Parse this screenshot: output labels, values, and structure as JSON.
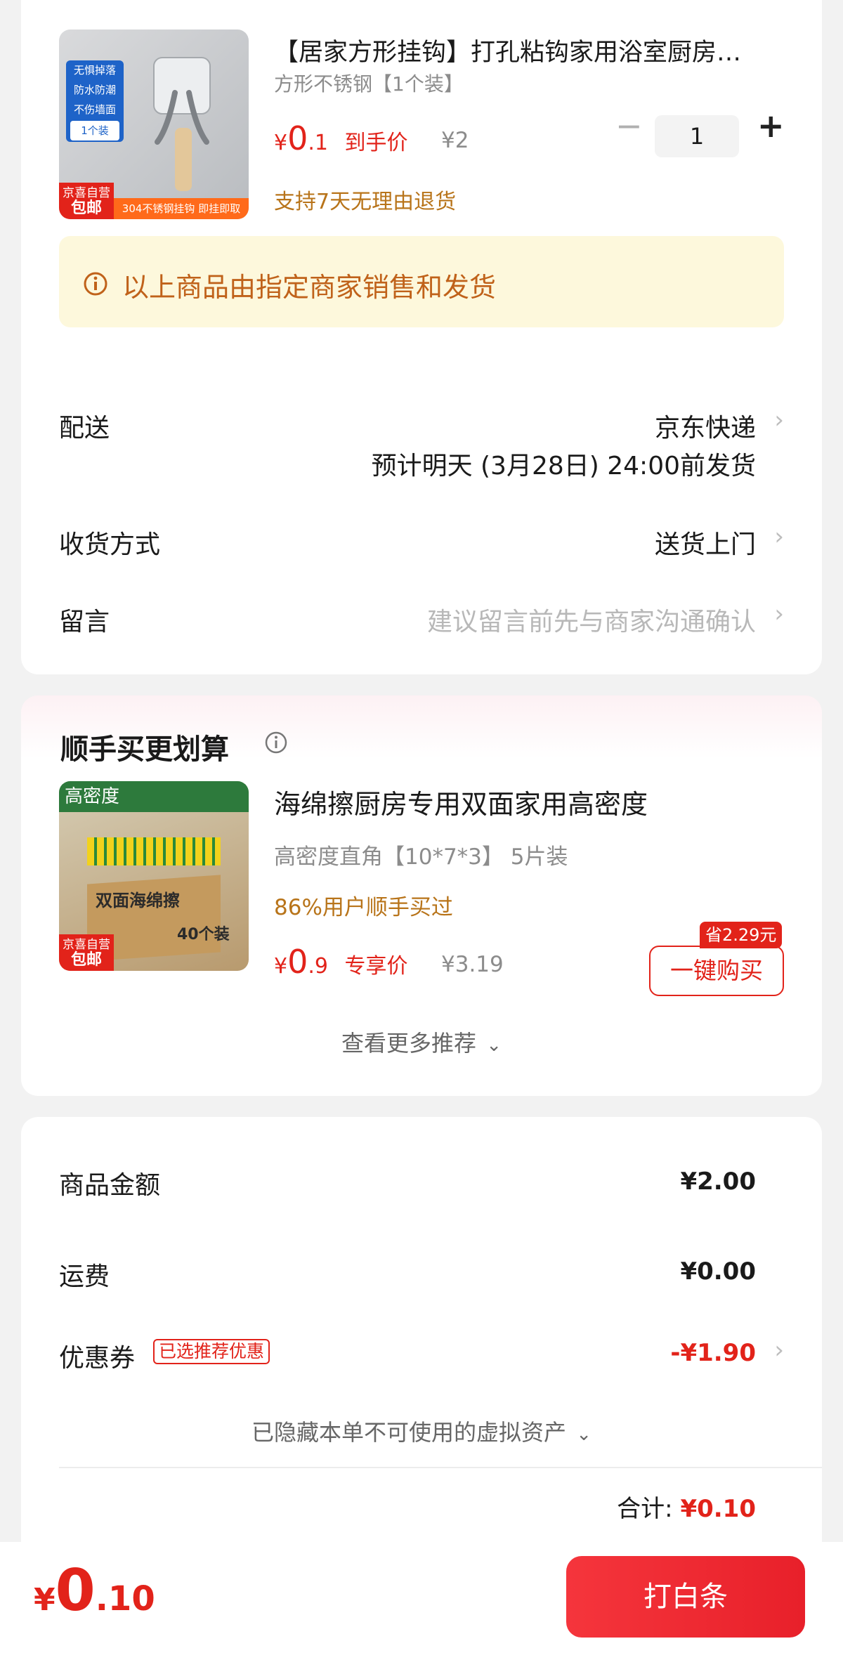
{
  "product": {
    "title": "【居家方形挂钩】打孔粘钩家用浴室厨房…",
    "spec": "方形不锈钢【1个装】",
    "currency": "¥",
    "price_int": "0",
    "price_dec": ".1",
    "price_tag": "到手价",
    "orig_price": "¥2",
    "quantity": "1",
    "minus": "−",
    "plus": "+",
    "return_policy": "支持7天无理由退货",
    "badge_line1": "京喜自营",
    "badge_line2": "包邮",
    "image_labels": [
      "无惧掉落",
      "防水防潮",
      "不伤墙面",
      "1个装"
    ],
    "image_footer": "304不锈钢挂钩 即挂即取"
  },
  "notice": {
    "icon": "info-icon",
    "text": "以上商品由指定商家销售和发货"
  },
  "delivery": {
    "label": "配送",
    "carrier": "京东快递",
    "eta": "预计明天 (3月28日) 24:00前发货"
  },
  "receive": {
    "label": "收货方式",
    "value": "送货上门"
  },
  "message": {
    "label": "留言",
    "placeholder": "建议留言前先与商家沟通确认"
  },
  "upsell": {
    "title": "顺手买更划算",
    "item": {
      "title": "海绵擦厨房专用双面家用高密度",
      "spec": "高密度直角【10*7*3】 5片装",
      "social": "86%用户顺手买过",
      "currency": "¥",
      "price_int": "0",
      "price_dec": ".9",
      "price_tag": "专享价",
      "orig_price": "¥3.19",
      "save_tag": "省2.29元",
      "buy_label": "一键购买",
      "badge_line1": "京喜自营",
      "badge_line2": "包邮",
      "image_top": "高密度",
      "image_box": "双面海绵擦",
      "image_count": "40个装"
    },
    "more": "查看更多推荐"
  },
  "summary": {
    "goods_label": "商品金额",
    "goods_value": "¥2.00",
    "shipping_label": "运费",
    "shipping_value": "¥0.00",
    "coupon_label": "优惠券",
    "coupon_tag": "已选推荐优惠",
    "coupon_value": "-¥1.90",
    "hidden_assets": "已隐藏本单不可使用的虚拟资产",
    "total_label": "合计:",
    "total_value": "¥0.10"
  },
  "bottom": {
    "currency": "¥",
    "amount_int": "0",
    "amount_dec": ".10",
    "pay_label": "打白条"
  },
  "colors": {
    "accent_red": "#e2231a",
    "notice_bg": "#fdf8dc",
    "orange_text": "#b8741a"
  }
}
